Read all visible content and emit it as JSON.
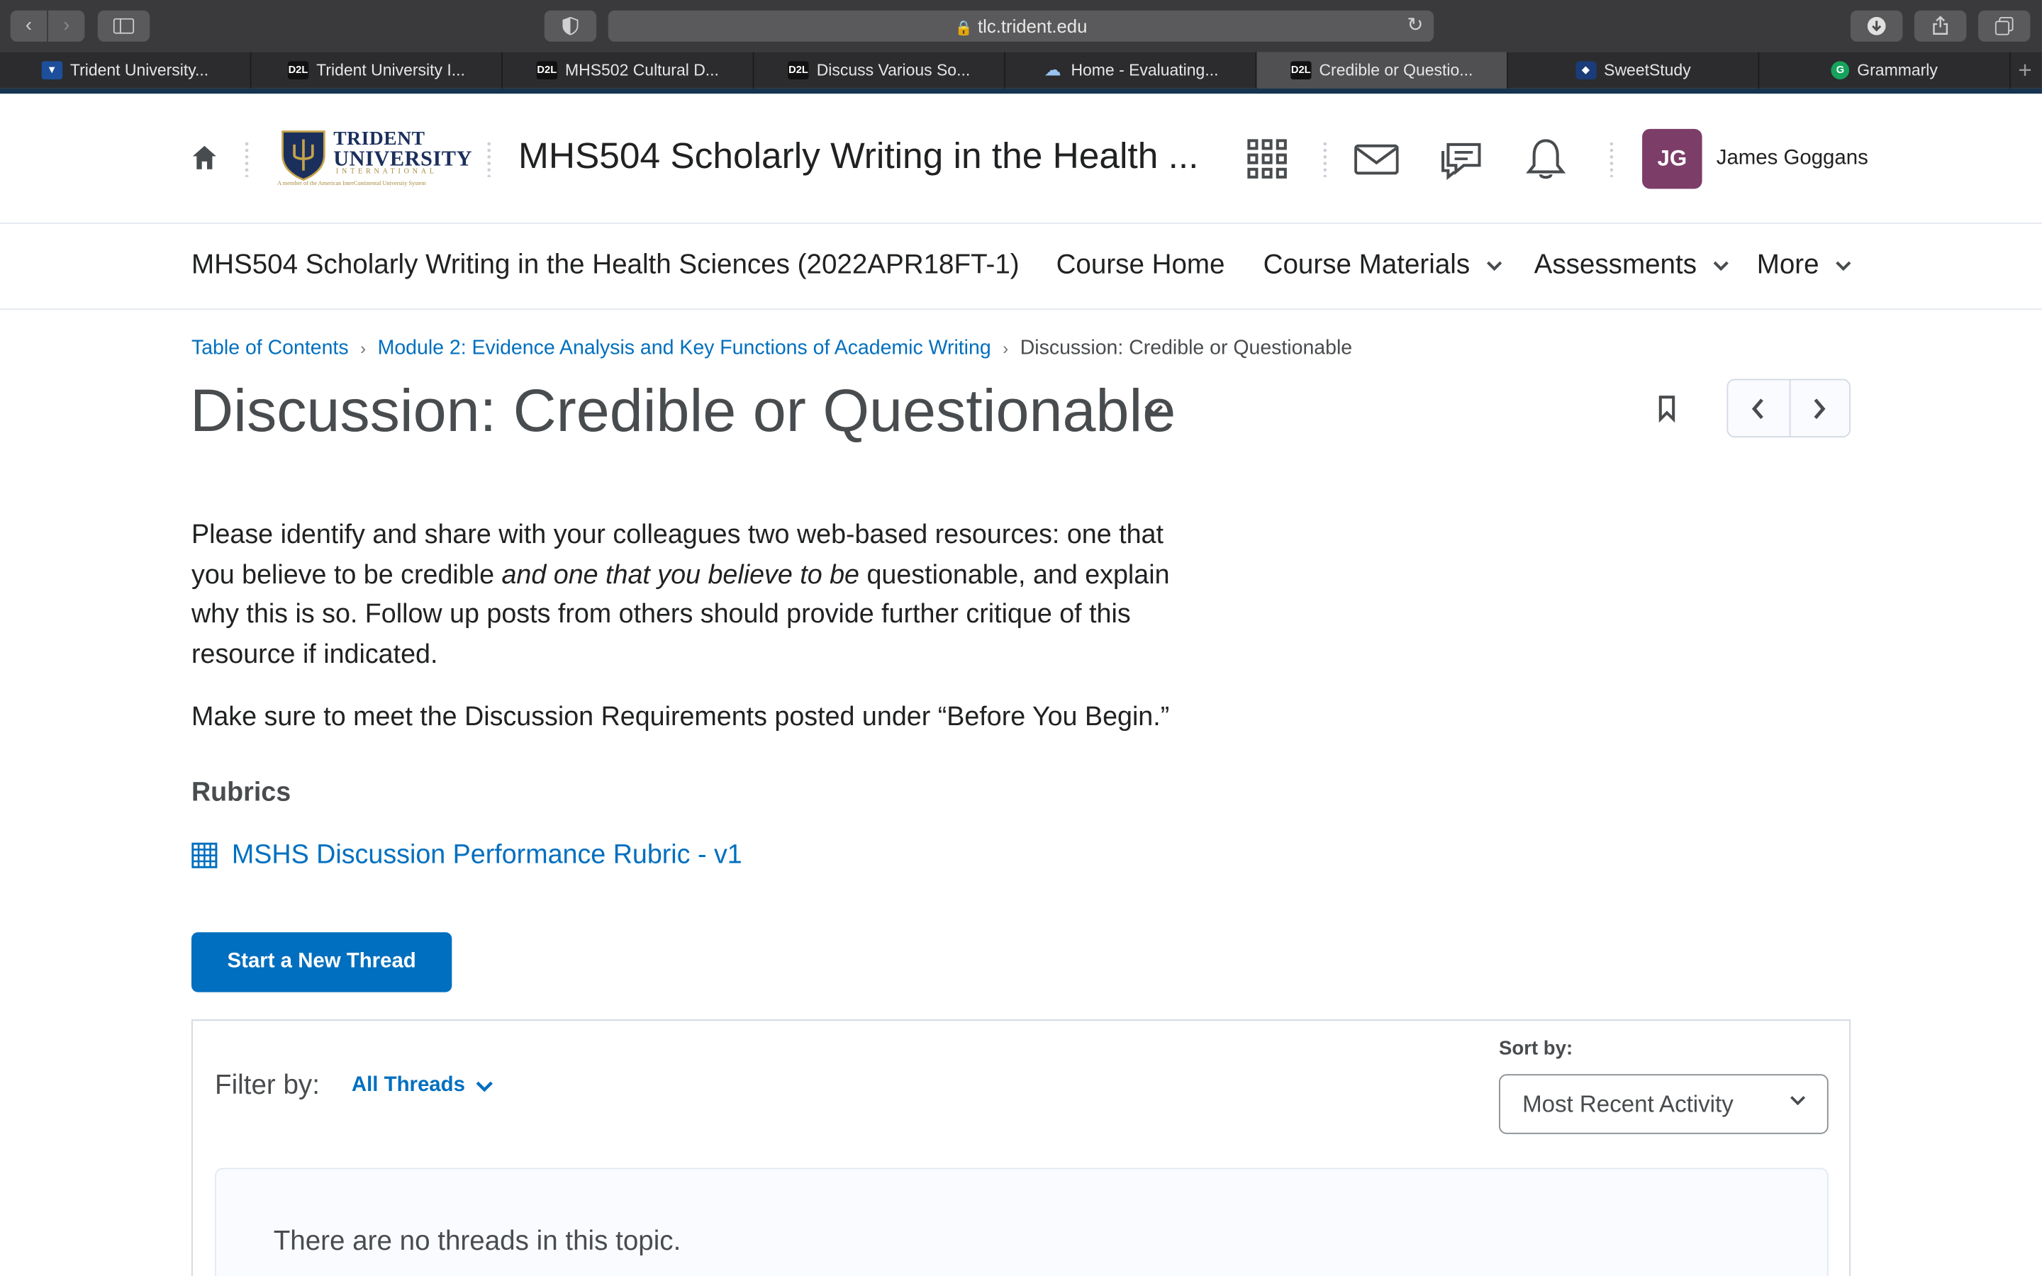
{
  "browser": {
    "url": "tlc.trident.edu",
    "tabs": [
      {
        "label": "Trident University...",
        "icon": "trident-favicon"
      },
      {
        "label": "Trident University I...",
        "icon": "d2l-favicon"
      },
      {
        "label": "MHS502 Cultural D...",
        "icon": "d2l-favicon"
      },
      {
        "label": "Discuss Various So...",
        "icon": "d2l-favicon"
      },
      {
        "label": "Home - Evaluating...",
        "icon": "cloud-favicon"
      },
      {
        "label": "Credible or Questio...",
        "icon": "d2l-favicon",
        "active": true
      },
      {
        "label": "SweetStudy",
        "icon": "sweetstudy-favicon"
      },
      {
        "label": "Grammarly",
        "icon": "grammarly-favicon"
      }
    ],
    "d2l_icon_text": "D2L"
  },
  "header": {
    "logo_line1": "TRIDENT",
    "logo_line2": "UNIVERSITY",
    "logo_line3": "INTERNATIONAL",
    "logo_line4": "A member of the American InterContinental University System",
    "course_title": "MHS504 Scholarly Writing in the Health ...",
    "avatar_initials": "JG",
    "user_name": "James Goggans"
  },
  "course_nav": {
    "course_name": "MHS504 Scholarly Writing in the Health Sciences (2022APR18FT-1)",
    "home": "Course Home",
    "materials": "Course Materials",
    "assessments": "Assessments",
    "more": "More"
  },
  "breadcrumb": {
    "toc": "Table of Contents",
    "module": "Module 2: Evidence Analysis and Key Functions of Academic Writing",
    "current": "Discussion: Credible or Questionable"
  },
  "page": {
    "title": "Discussion: Credible or Questionable",
    "desc_part1": "Please identify and share with your colleagues two web-based resources: one that you believe to be credible ",
    "desc_italic": "and one that you believe to be",
    "desc_part2": " questionable, and explain why this is so. Follow up posts from others should provide further critique of this resource if indicated.",
    "desc2": "Make sure to meet the Discussion Requirements posted under “Before You Begin.”",
    "rubrics_heading": "Rubrics",
    "rubric_link": "MSHS Discussion Performance Rubric - v1",
    "new_thread_label": "Start a New Thread"
  },
  "threads": {
    "filter_label": "Filter by:",
    "filter_value": "All Threads",
    "sort_label": "Sort by:",
    "sort_value": "Most Recent Activity",
    "empty_message": "There are no threads in this topic."
  },
  "colors": {
    "link": "#006fbf",
    "primary_button": "#006fbf",
    "avatar": "#7c3d69",
    "header_accent": "#16334f"
  }
}
